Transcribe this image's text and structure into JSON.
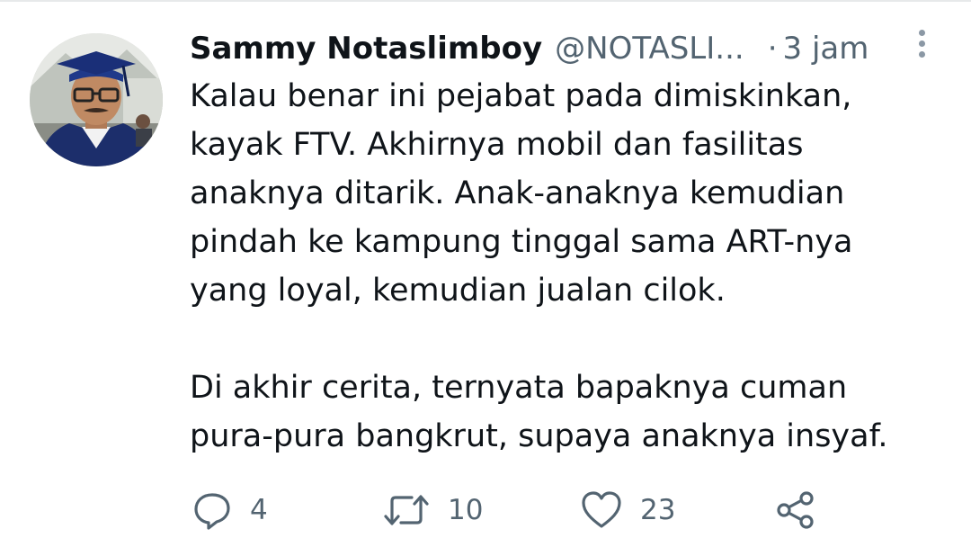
{
  "tweet": {
    "display_name": "Sammy Notaslimboy",
    "handle": "@NOTASLI...",
    "separator": "·",
    "time": "3 jam",
    "text_lines": [
      "Kalau benar ini pejabat pada dimiskinkan,",
      "kayak FTV. Akhirnya mobil dan fasilitas",
      "anaknya ditarik. Anak-anaknya kemudian",
      "pindah ke kampung tinggal sama ART-nya",
      "yang loyal, kemudian jualan cilok."
    ],
    "text_lines_2": [
      "Di akhir cerita, ternyata bapaknya cuman",
      "pura-pura bangkrut, supaya anaknya insyaf."
    ]
  },
  "actions": {
    "reply": {
      "icon": "reply-icon",
      "count": "4"
    },
    "retweet": {
      "icon": "retweet-icon",
      "count": "10"
    },
    "like": {
      "icon": "heart-icon",
      "count": "23"
    },
    "share": {
      "icon": "share-icon"
    }
  },
  "colors": {
    "text": "#0f1419",
    "secondary": "#536471",
    "icon": "#536471"
  }
}
